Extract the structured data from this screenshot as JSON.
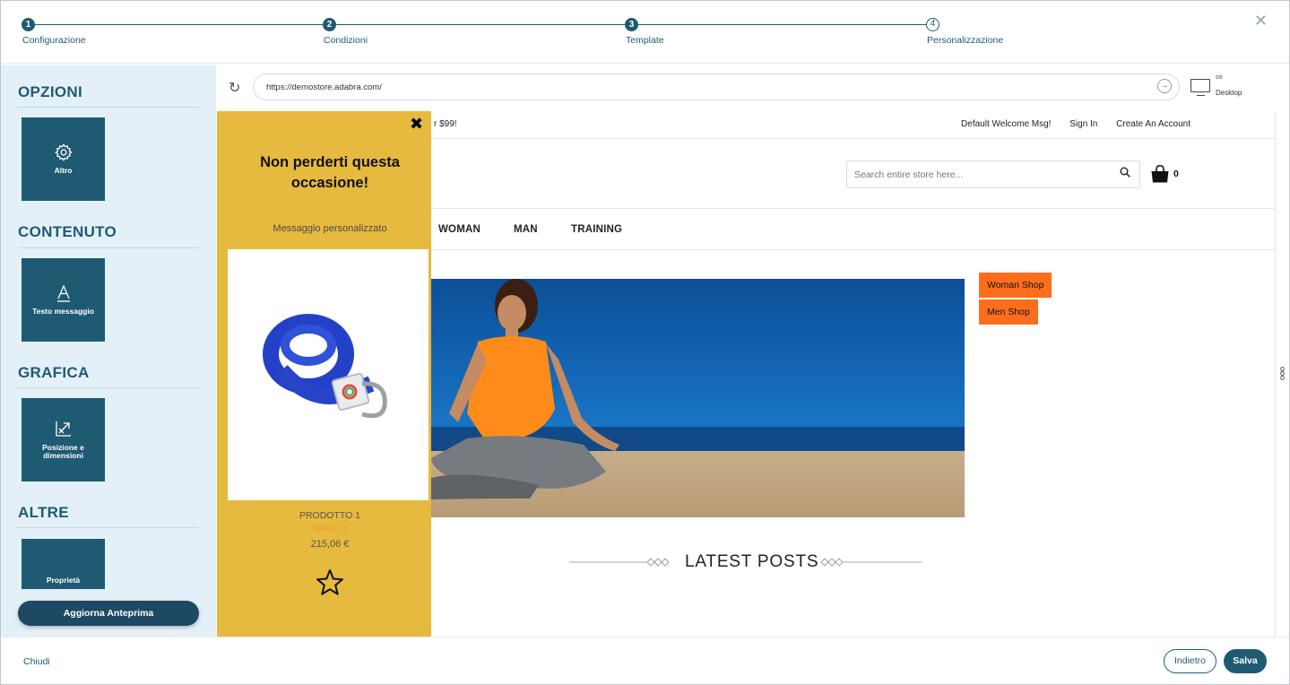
{
  "stepper": {
    "steps": [
      {
        "num": "1",
        "label": "Configurazione"
      },
      {
        "num": "2",
        "label": "Condizioni"
      },
      {
        "num": "3",
        "label": "Template"
      },
      {
        "num": "4",
        "label": "Personalizzazione"
      }
    ]
  },
  "sidebar": {
    "sections": [
      {
        "title": "OPZIONI",
        "tile": "Altro",
        "icon": "gear-icon"
      },
      {
        "title": "CONTENUTO",
        "tile": "Testo messaggio",
        "icon": "text-icon"
      },
      {
        "title": "GRAFICA",
        "tile": "Posizione e dimensioni",
        "icon": "resize-icon"
      },
      {
        "title": "ALTRE",
        "tile": "Proprietà",
        "icon": "properties-icon"
      }
    ],
    "update_button": "Aggiorna Anteprima"
  },
  "urlbar": {
    "url": "https://demostore.adabra.com/",
    "device_symbol": "∞",
    "device_label": "Desktop"
  },
  "store": {
    "promo": "r $99!",
    "links": [
      "Default Welcome Msg!",
      "Sign In",
      "Create An Account"
    ],
    "search_placeholder": "Search entire store here...",
    "cart_count": "0",
    "nav": [
      "WOMAN",
      "MAN",
      "TRAINING"
    ],
    "shop_buttons": [
      "Woman Shop",
      "Men Shop"
    ],
    "latest_posts": "LATEST POSTS",
    "accent": "#fe6d1c"
  },
  "popup": {
    "close": "✖",
    "title": "Non perderti questa occasione!",
    "message": "Messaggio personalizzato",
    "product_name": "PRODOTTO 1",
    "brand": "BRAND_1",
    "price": "215,06 €",
    "background": "#e6b93f"
  },
  "footer": {
    "close": "Chiudi",
    "back": "Indietro",
    "save": "Salva"
  }
}
